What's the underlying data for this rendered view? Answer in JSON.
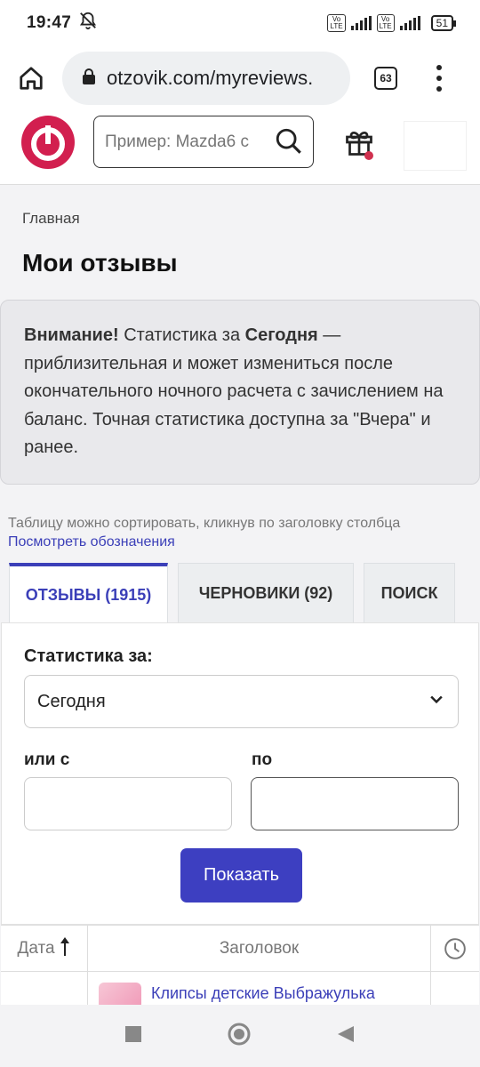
{
  "status": {
    "time": "19:47",
    "battery": "51",
    "volte1": "Vo\nLTE",
    "volte2": "Vo\nLTE",
    "net": "4G"
  },
  "browser": {
    "url": "otzovik.com/myreviews.",
    "tab_count": "63"
  },
  "header": {
    "search_placeholder": "Пример: Mazda6 с"
  },
  "breadcrumb": "Главная",
  "page_title": "Мои отзывы",
  "notice": {
    "strong1": "Внимание!",
    "text1": " Статистика за ",
    "strong2": "Сегодня",
    "text2": " — приблизительная и может измениться после окончательного ночного расчета с зачислением на баланс. Точная статистика доступна за \"Вчера\" и ранее."
  },
  "hint": "Таблицу можно сортировать, кликнув по заголовку столбца",
  "legend_link": "Посмотреть обозначения",
  "tabs": [
    {
      "label": "ОТЗЫВЫ (1915)"
    },
    {
      "label": "ЧЕРНОВИКИ (92)"
    },
    {
      "label": "ПОИСК"
    }
  ],
  "stats": {
    "label": "Статистика за:",
    "period_selected": "Сегодня",
    "from_label": "или с",
    "to_label": "по",
    "show_button": "Показать"
  },
  "table": {
    "col_date": "Дата",
    "col_title": "Заголовок",
    "rows": [
      {
        "title": "Клипсы детские Выбражулька"
      }
    ]
  }
}
